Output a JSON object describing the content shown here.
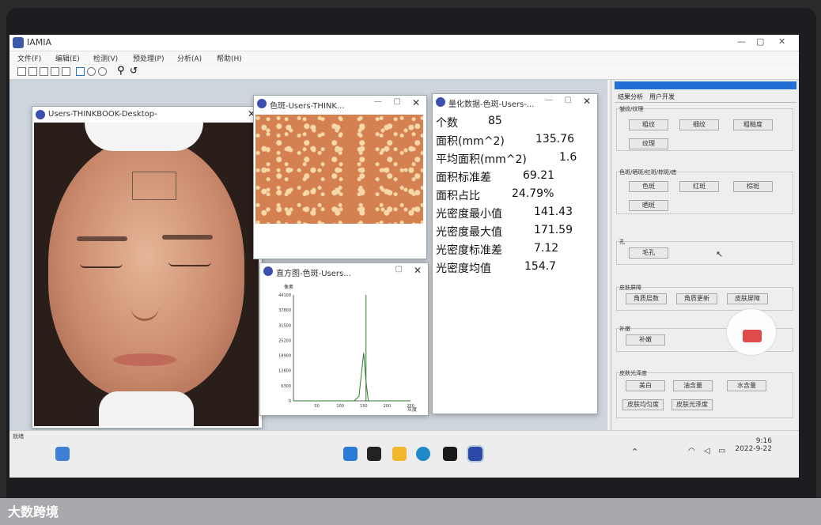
{
  "app": {
    "title": "IAMIA"
  },
  "menu": [
    "文件(F)",
    "编辑(E)",
    "检测(V)",
    "预处理(P)",
    "分析(A)",
    "帮助(H)"
  ],
  "windows": {
    "face": {
      "title": "Users-THINKBOOK-Desktop-"
    },
    "spots": {
      "title": "色斑-Users-THINK..."
    },
    "histogram": {
      "title": "直方图-色斑-Users...",
      "y_ticks": [
        "44100",
        "37800",
        "31500",
        "25200",
        "18900",
        "12600",
        "6300",
        "0"
      ],
      "x_ticks": [
        "50",
        "100",
        "150",
        "200",
        "250"
      ],
      "ylabel": "像素",
      "xlabel": "灰度"
    },
    "data": {
      "title": "量化数据-色斑-Users-...",
      "rows": [
        {
          "label": "个数",
          "value": "85"
        },
        {
          "label": "面积(mm^2)",
          "value": "135.76"
        },
        {
          "label": "平均面积(mm^2)",
          "value": "1.6"
        },
        {
          "label": "面积标准差",
          "value": "69.21"
        },
        {
          "label": "面积占比",
          "value": "24.79%"
        },
        {
          "label": "光密度最小值",
          "value": "141.43"
        },
        {
          "label": "光密度最大值",
          "value": "171.59"
        },
        {
          "label": "光密度标准差",
          "value": "7.12"
        },
        {
          "label": "光密度均值",
          "value": "154.7"
        }
      ]
    }
  },
  "chart_data": {
    "type": "line",
    "x": [
      0,
      50,
      100,
      130,
      140,
      150,
      155,
      160,
      200,
      250
    ],
    "y": [
      0,
      0,
      0,
      0,
      2000,
      20000,
      8000,
      0,
      0,
      0
    ],
    "spike_x": 155,
    "spike_y": 44100,
    "ylim": [
      0,
      44100
    ],
    "xlim": [
      0,
      250
    ],
    "ylabel": "像素",
    "xlabel": "灰度"
  },
  "panel": {
    "tabs": [
      "结果分析",
      "用户开发"
    ],
    "groups": [
      {
        "label": "皱纹/纹理",
        "buttons": [
          "粗纹",
          "细纹",
          "粗糙度",
          "纹理"
        ]
      },
      {
        "label": "色斑/晒斑/红斑/棕斑/痣",
        "buttons": [
          "色斑",
          "红斑",
          "棕斑",
          "晒斑"
        ]
      },
      {
        "label": "孔",
        "buttons": [
          "毛孔"
        ]
      },
      {
        "label": "皮肤屏障",
        "buttons": [
          "角质层数",
          "角质更新",
          "皮肤屏障"
        ]
      },
      {
        "label": "补嫩",
        "buttons": [
          "补嫩"
        ]
      },
      {
        "label": "皮肤光泽度",
        "buttons": [
          "美白",
          "油含量",
          "水含量",
          "皮肤均匀度",
          "皮肤光泽度"
        ]
      }
    ]
  },
  "status": {
    "left": "就绪"
  },
  "clock": {
    "time": "9:16",
    "date": "2022-9-22"
  },
  "watermark": "大数跨境"
}
